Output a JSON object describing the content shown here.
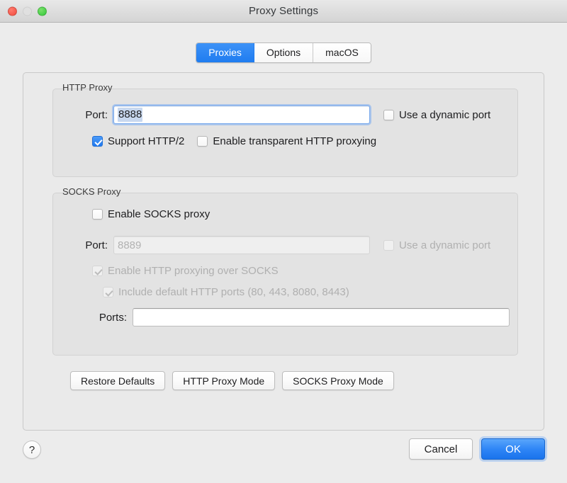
{
  "window": {
    "title": "Proxy Settings",
    "traffic_lights": [
      {
        "name": "close",
        "color": "#f24b3e"
      },
      {
        "name": "minimize",
        "color": "#e0e0e0"
      },
      {
        "name": "zoom",
        "color": "#33c93a"
      }
    ]
  },
  "tabs": [
    {
      "label": "Proxies",
      "active": true
    },
    {
      "label": "Options",
      "active": false
    },
    {
      "label": "macOS",
      "active": false
    }
  ],
  "http_proxy": {
    "group_label": "HTTP Proxy",
    "port_label": "Port:",
    "port_value": "8888",
    "dynamic_port_label": "Use a dynamic port",
    "dynamic_port_checked": false,
    "support_http2_label": "Support HTTP/2",
    "support_http2_checked": true,
    "transparent_label": "Enable transparent HTTP proxying",
    "transparent_checked": false
  },
  "socks_proxy": {
    "group_label": "SOCKS Proxy",
    "enable_label": "Enable SOCKS proxy",
    "enable_checked": false,
    "port_label": "Port:",
    "port_placeholder": "8889",
    "port_value": "",
    "dynamic_port_label": "Use a dynamic port",
    "dynamic_port_checked": false,
    "http_over_socks_label": "Enable HTTP proxying over SOCKS",
    "http_over_socks_checked": true,
    "include_default_ports_label": "Include default HTTP ports (80, 443, 8080, 8443)",
    "include_default_ports_checked": true,
    "ports_label": "Ports:",
    "ports_value": ""
  },
  "mode_buttons": [
    {
      "label": "Restore Defaults"
    },
    {
      "label": "HTTP Proxy Mode"
    },
    {
      "label": "SOCKS Proxy Mode"
    }
  ],
  "footer": {
    "help_glyph": "?",
    "cancel_label": "Cancel",
    "ok_label": "OK"
  },
  "colors": {
    "accent_blue": "#1f7cf0",
    "selection_blue": "#c8d8ef",
    "panel_bg": "#eaeaea",
    "group_bg": "#e3e3e3",
    "disabled_text": "#b0b0b0"
  }
}
